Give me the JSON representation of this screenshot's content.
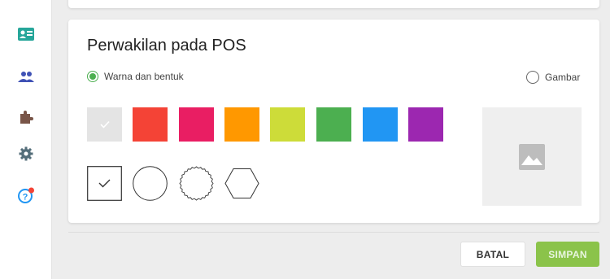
{
  "sidebar": {
    "items": [
      {
        "icon": "contact-card-icon",
        "color": "#26a69a"
      },
      {
        "icon": "people-icon",
        "color": "#3f51b5"
      },
      {
        "icon": "puzzle-icon",
        "color": "#795548"
      },
      {
        "icon": "gear-icon",
        "color": "#546e7a"
      },
      {
        "icon": "help-icon",
        "color": "#2196f3",
        "badge_color": "#f44336"
      }
    ]
  },
  "section": {
    "title": "Perwakilan pada POS",
    "options": [
      {
        "label": "Warna dan bentuk",
        "selected": true
      },
      {
        "label": "Gambar",
        "selected": false
      }
    ],
    "colors": [
      "#e0e0e0",
      "#f44336",
      "#e91e63",
      "#ff9800",
      "#cddc39",
      "#4caf50",
      "#2196f3",
      "#9c27b0"
    ],
    "selected_color_index": 0,
    "shapes": [
      "square",
      "circle",
      "badge",
      "hexagon"
    ],
    "selected_shape_index": 0,
    "image_placeholder_icon": "image-icon"
  },
  "footer": {
    "cancel_label": "BATAL",
    "save_label": "SIMPAN",
    "save_color": "#8bc34a"
  }
}
